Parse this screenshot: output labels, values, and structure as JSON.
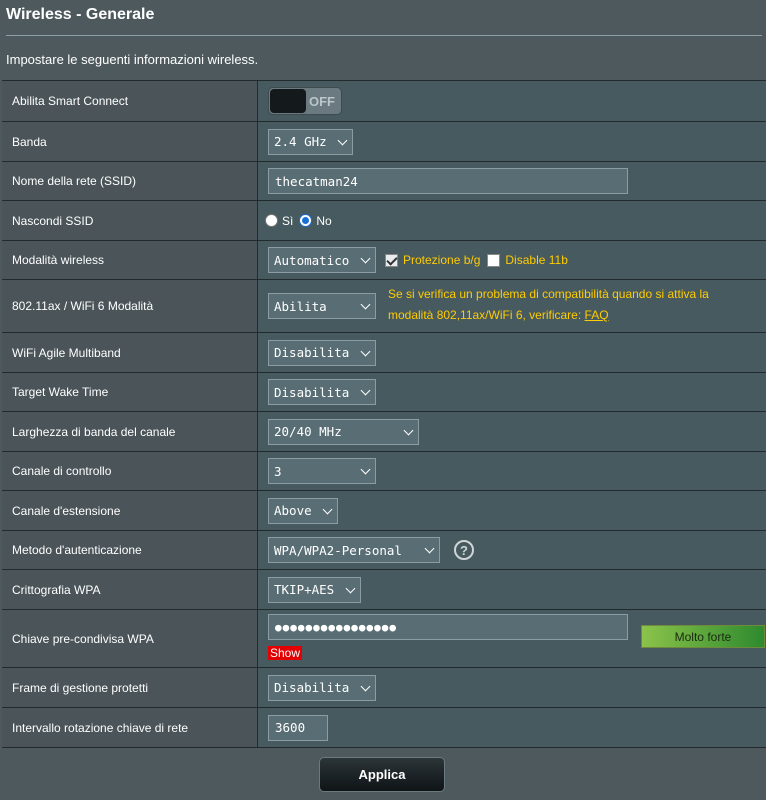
{
  "page": {
    "title": "Wireless - Generale",
    "subtitle": "Impostare le seguenti informazioni wireless."
  },
  "rows": {
    "smart_connect": {
      "label": "Abilita Smart Connect",
      "toggle": "OFF"
    },
    "band": {
      "label": "Banda",
      "value": "2.4 GHz"
    },
    "ssid": {
      "label": "Nome della rete (SSID)",
      "value": "thecatman24"
    },
    "hide_ssid": {
      "label": "Nascondi SSID",
      "opt_yes": "Sì",
      "opt_no": "No",
      "selected": "No"
    },
    "wireless_mode": {
      "label": "Modalità wireless",
      "value": "Automatico",
      "protect_label": "Protezione b/g",
      "protect_checked": true,
      "disable11b_label": "Disable 11b",
      "disable11b_checked": false
    },
    "ax_mode": {
      "label": "802.11ax / WiFi 6 Modalità",
      "value": "Abilita",
      "note_line1": "Se si verifica un problema di compatibilità quando si attiva la",
      "note_line2": "modalità 802,11ax/WiFi 6, verificare:",
      "note_link": "FAQ"
    },
    "agile_multiband": {
      "label": "WiFi Agile Multiband",
      "value": "Disabilita"
    },
    "twt": {
      "label": "Target Wake Time",
      "value": "Disabilita"
    },
    "bandwidth": {
      "label": "Larghezza di banda del canale",
      "value": "20/40 MHz"
    },
    "control_channel": {
      "label": "Canale di controllo",
      "value": "3"
    },
    "ext_channel": {
      "label": "Canale d'estensione",
      "value": "Above"
    },
    "auth_method": {
      "label": "Metodo d'autenticazione",
      "value": "WPA/WPA2-Personal",
      "help": "?"
    },
    "wpa_encryption": {
      "label": "Crittografia WPA",
      "value": "TKIP+AES"
    },
    "wpa_key": {
      "label": "Chiave pre-condivisa WPA",
      "value": "●●●●●●●●●●●●●●●●",
      "strength": "Molto forte",
      "show": "Show"
    },
    "pmf": {
      "label": "Frame di gestione protetti",
      "value": "Disabilita"
    },
    "key_rotation": {
      "label": "Intervallo rotazione chiave di rete",
      "value": "3600"
    }
  },
  "actions": {
    "apply": "Applica"
  },
  "colors": {
    "background": "#4d595d",
    "accent_yellow": "#ffcc00",
    "strength_green": "#4caf50",
    "show_red": "#e20000"
  }
}
